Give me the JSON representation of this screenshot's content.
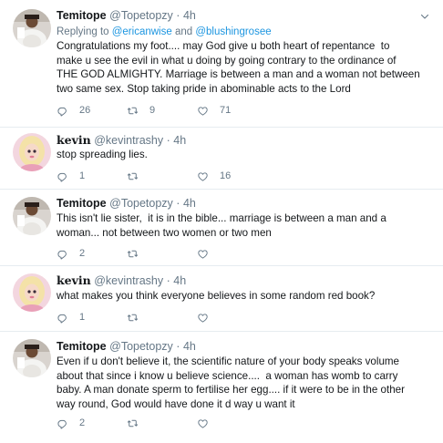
{
  "colors": {
    "accent": "#1b95e0",
    "muted": "#657786",
    "divider": "#e6ecf0"
  },
  "tweets": [
    {
      "name": "Temitope",
      "handle": "@Topetopzy",
      "dot": "·",
      "time": "4h",
      "reply_prefix": "Replying to ",
      "reply_user1": "@ericanwise",
      "reply_and": " and ",
      "reply_user2": "@blushingrosee",
      "text": "Congratulations my foot.... may God give u both heart of repentance  to\nmake u see the evil in what u doing by going contrary to the ordinance of\nTHE GOD ALMIGHTY. Marriage is between a man and a woman not between\ntwo same sex. Stop taking pride in abominable acts to the Lord",
      "replies": "26",
      "retweets": "9",
      "likes": "71"
    },
    {
      "name": "kevin",
      "handle": "@kevintrashy",
      "dot": "·",
      "time": "4h",
      "text": "stop spreading lies.",
      "replies": "1",
      "retweets": "",
      "likes": "16"
    },
    {
      "name": "Temitope",
      "handle": "@Topetopzy",
      "dot": "·",
      "time": "4h",
      "text": "This isn't lie sister,  it is in the bible... marriage is between a man and a\nwoman... not between two women or two men",
      "replies": "2",
      "retweets": "",
      "likes": ""
    },
    {
      "name": "kevin",
      "handle": "@kevintrashy",
      "dot": "·",
      "time": "4h",
      "text": "what makes you think everyone believes in some random red book?",
      "replies": "1",
      "retweets": "",
      "likes": ""
    },
    {
      "name": "Temitope",
      "handle": "@Topetopzy",
      "dot": "·",
      "time": "4h",
      "text": "Even if u don't believe it, the scientific nature of your body speaks volume\nabout that since i know u believe science....  a woman has womb to carry\nbaby. A man donate sperm to fertilise her egg.... if it were to be in the other\nway round, God would have done it d way u want it",
      "replies": "2",
      "retweets": "",
      "likes": ""
    }
  ]
}
